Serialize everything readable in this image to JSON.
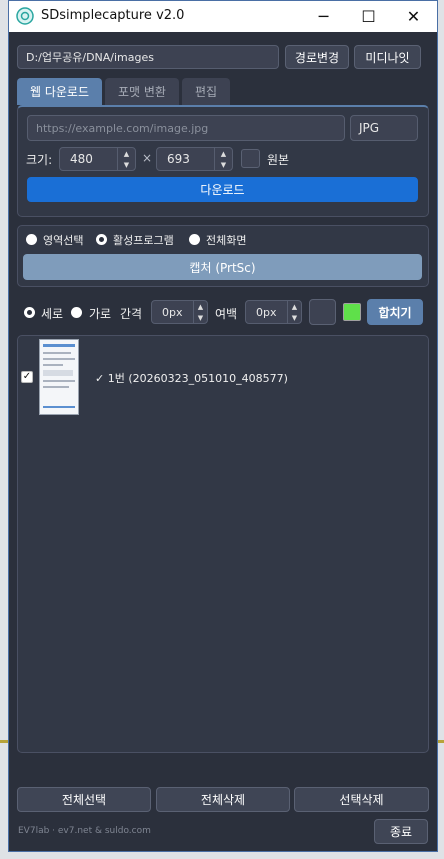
{
  "window": {
    "title": "SDsimplecapture  v2.0",
    "minimize": "─",
    "maximize": "☐",
    "close": "✕"
  },
  "path": {
    "value": "D:/업무공유/DNA/images",
    "change_button": "경로변경",
    "media_button": "미디나잇"
  },
  "tabs": [
    "웹 다운로드",
    "포맷 변환",
    "편집"
  ],
  "web_download": {
    "url_placeholder": "https://example.com/image.jpg",
    "format": "JPG",
    "size_label": "크기:",
    "width": "480",
    "times": "×",
    "height": "693",
    "original_label": "원본",
    "download_button": "다운로드"
  },
  "capture": {
    "modes": [
      "영역선택",
      "활성프로그램",
      "전체화면"
    ],
    "selected_mode": "활성프로그램",
    "capture_button": "캡처 (PrtSc)"
  },
  "merge": {
    "orientation": [
      "세로",
      "가로"
    ],
    "selected_orientation": "세로",
    "gap_label": "간격",
    "gap_value": "0px",
    "margin_label": "여백",
    "margin_value": "0px",
    "merge_button": "합치기",
    "color_swatch": "#5fe04a"
  },
  "list": {
    "items": [
      {
        "label": "✓  1번  (20260323_051010_408577)",
        "checked": true
      }
    ]
  },
  "bottom": {
    "select_all": "전체선택",
    "delete_all": "전체삭제",
    "delete_selected": "선택삭제",
    "credits": "EV7lab · ev7.net & suldo.com",
    "exit": "종료"
  },
  "colors": {
    "accent_blue": "#1a6fd6",
    "capture_button": "#7f9cbb",
    "window_bg": "#2b303c"
  }
}
